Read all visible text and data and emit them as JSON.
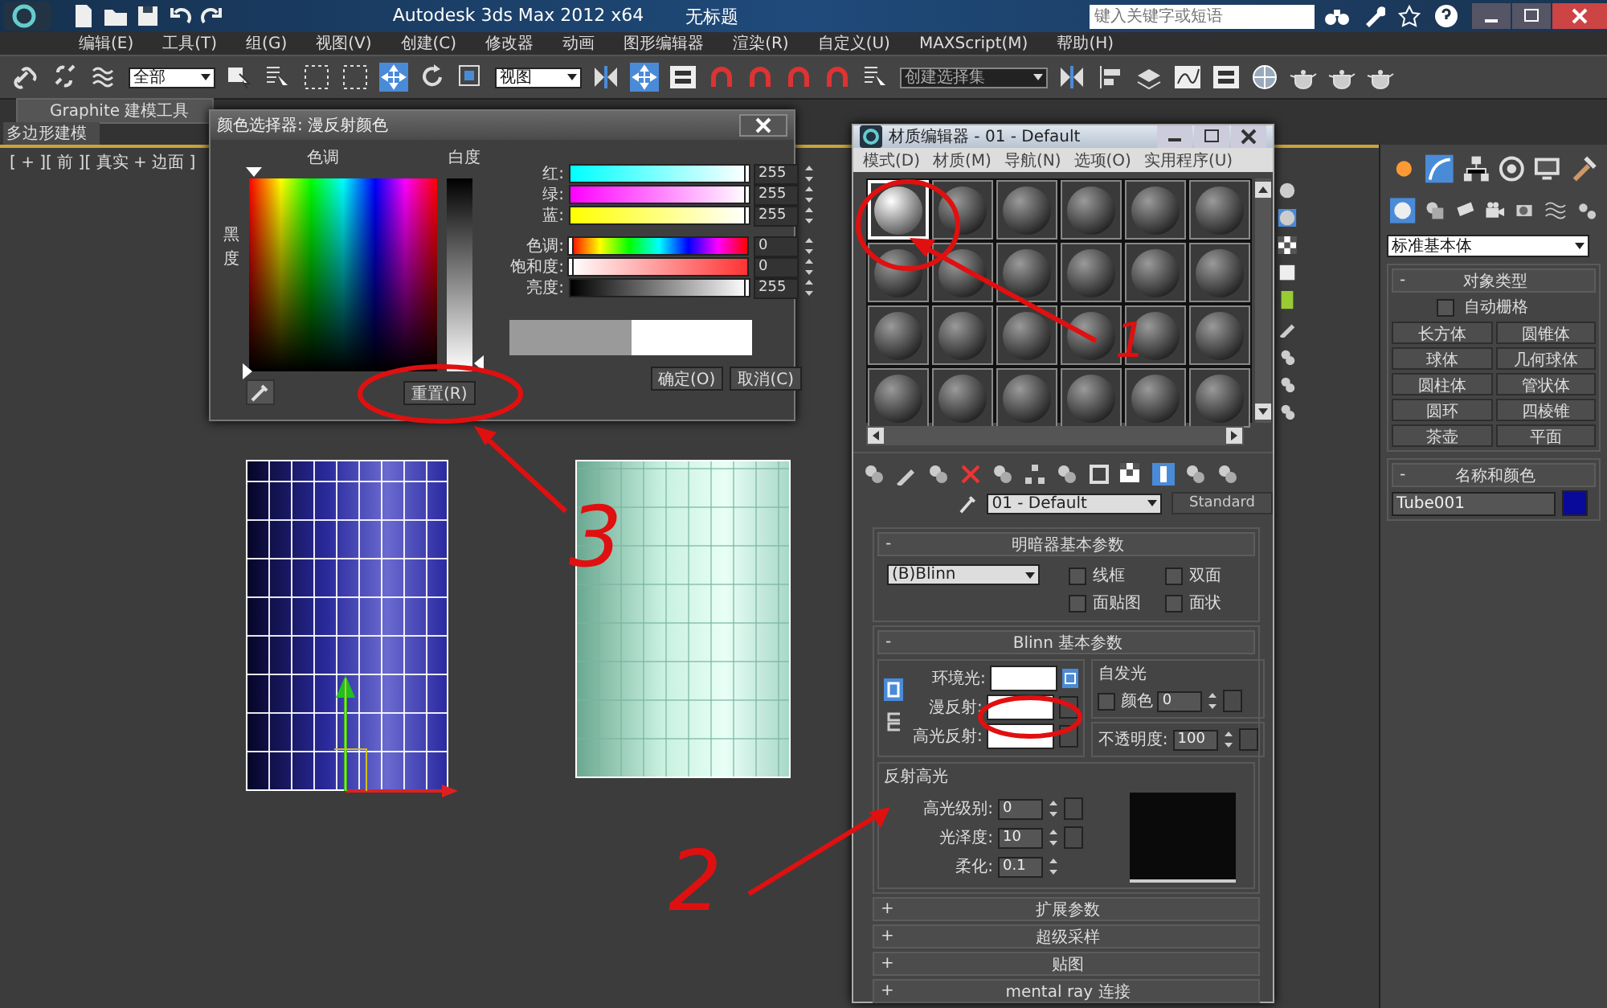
{
  "window": {
    "app_title": "Autodesk 3ds Max  2012 x64",
    "file_title": "无标题",
    "search_placeholder": "键入关键字或短语"
  },
  "menu": [
    "编辑(E)",
    "工具(T)",
    "组(G)",
    "视图(V)",
    "创建(C)",
    "修改器",
    "动画",
    "图形编辑器",
    "渲染(R)",
    "自定义(U)",
    "MAXScript(M)",
    "帮助(H)"
  ],
  "toolbar": {
    "selection_filter": "全部",
    "reference_coord": "视图",
    "named_selection": "创建选择集"
  },
  "ribbon": {
    "tab": "Graphite 建模工具",
    "subtab": "多边形建模"
  },
  "viewport": {
    "label": "[ + ][ 前 ][ 真实 + 边面 ]"
  },
  "color_picker": {
    "title": "颜色选择器: 漫反射颜色",
    "hue_label": "色调",
    "whiteness_label": "白度",
    "blackness_label": "黑度",
    "sliders": [
      {
        "label": "红:",
        "value": "255",
        "kind": "red",
        "level": 1
      },
      {
        "label": "绿:",
        "value": "255",
        "kind": "green",
        "level": 1
      },
      {
        "label": "蓝:",
        "value": "255",
        "kind": "blue",
        "level": 1
      },
      {
        "label": "色调:",
        "value": "0",
        "kind": "hue",
        "level": 0
      },
      {
        "label": "饱和度:",
        "value": "0",
        "kind": "saturation",
        "level": 0
      },
      {
        "label": "亮度:",
        "value": "255",
        "kind": "value",
        "level": 1
      }
    ],
    "buttons": [
      {
        "label": "重置(R)",
        "kind": "reset"
      },
      {
        "label": "确定(O)",
        "kind": "ok"
      },
      {
        "label": "取消(C)",
        "kind": "cancel"
      }
    ]
  },
  "material_editor": {
    "title": "材质编辑器 - 01 - Default",
    "menu": [
      "模式(D)",
      "材质(M)",
      "导航(N)",
      "选项(O)",
      "实用程序(U)"
    ],
    "slots": [
      {
        "selected": true
      },
      {
        "selected": false
      },
      {
        "selected": false
      },
      {
        "selected": false
      },
      {
        "selected": false
      },
      {
        "selected": false
      },
      {
        "selected": false
      },
      {
        "selected": false
      },
      {
        "selected": false
      },
      {
        "selected": false
      },
      {
        "selected": false
      },
      {
        "selected": false
      },
      {
        "selected": false
      },
      {
        "selected": false
      },
      {
        "selected": false
      },
      {
        "selected": false
      },
      {
        "selected": false
      },
      {
        "selected": false
      },
      {
        "selected": false
      },
      {
        "selected": false
      },
      {
        "selected": false
      },
      {
        "selected": false
      },
      {
        "selected": false
      },
      {
        "selected": false
      }
    ],
    "material_name": "01 - Default",
    "material_type": "Standard",
    "shader_rollout": {
      "title": "明暗器基本参数",
      "toggle": "-",
      "shader": "(B)Blinn",
      "options": [
        {
          "label": "线框",
          "checked": false
        },
        {
          "label": "双面",
          "checked": false
        },
        {
          "label": "面贴图",
          "checked": false
        },
        {
          "label": "面状",
          "checked": false
        }
      ]
    },
    "blinn_rollout": {
      "title": "Blinn 基本参数",
      "toggle": "-",
      "ambient_label": "环境光:",
      "diffuse_label": "漫反射:",
      "specular_label": "高光反射:",
      "self_illum": {
        "title": "自发光",
        "label": "颜色",
        "checked": false,
        "value": "0"
      },
      "opacity": {
        "label": "不透明度:",
        "value": "100"
      },
      "highlights": {
        "title": "反射高光",
        "fields": [
          {
            "label": "高光级别:",
            "value": "0"
          },
          {
            "label": "光泽度:",
            "value": "10"
          },
          {
            "label": "柔化:",
            "value": "0.1"
          }
        ]
      }
    },
    "collapsed_rollouts": [
      {
        "toggle": "+",
        "title": "扩展参数"
      },
      {
        "toggle": "+",
        "title": "超级采样"
      },
      {
        "toggle": "+",
        "title": "贴图"
      },
      {
        "toggle": "+",
        "title": "mental ray 连接"
      }
    ]
  },
  "command_panel": {
    "category": "标准基本体",
    "object_type": {
      "toggle": "-",
      "title": "对象类型",
      "autogrid": {
        "label": "自动栅格",
        "checked": false
      },
      "buttons": [
        "长方体",
        "圆锥体",
        "球体",
        "几何球体",
        "圆柱体",
        "管状体",
        "圆环",
        "四棱锥",
        "茶壶",
        "平面"
      ]
    },
    "name_color": {
      "toggle": "-",
      "title": "名称和颜色",
      "name": "Tube001",
      "color": "#0a0a9a"
    }
  },
  "annotations": [
    {
      "number": "1"
    },
    {
      "number": "2"
    },
    {
      "number": "3"
    }
  ]
}
